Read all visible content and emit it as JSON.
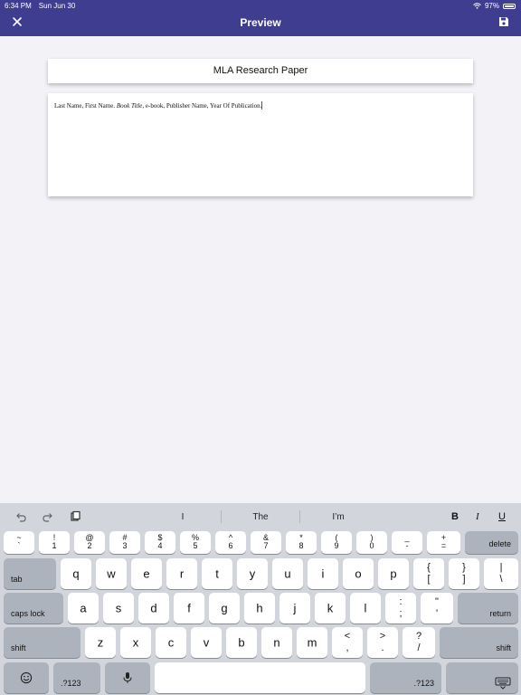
{
  "status_bar": {
    "time": "6:34 PM",
    "date": "Sun Jun 30",
    "battery": "97%"
  },
  "nav": {
    "title": "Preview"
  },
  "document": {
    "title": "MLA Research Paper",
    "citation_pre": "Last Name, First Name. ",
    "citation_italic": "Book Title",
    "citation_post": ", e-book, Publisher Name, Year Of Publication."
  },
  "keyboard": {
    "suggestions": [
      "I",
      "The",
      "I’m"
    ],
    "format": {
      "bold": "B",
      "italic": "I",
      "underline": "U"
    },
    "number_row": [
      {
        "top": "~",
        "bottom": "`"
      },
      {
        "top": "!",
        "bottom": "1"
      },
      {
        "top": "@",
        "bottom": "2"
      },
      {
        "top": "#",
        "bottom": "3"
      },
      {
        "top": "$",
        "bottom": "4"
      },
      {
        "top": "%",
        "bottom": "5"
      },
      {
        "top": "^",
        "bottom": "6"
      },
      {
        "top": "&",
        "bottom": "7"
      },
      {
        "top": "*",
        "bottom": "8"
      },
      {
        "top": "(",
        "bottom": "9"
      },
      {
        "top": ")",
        "bottom": "0"
      },
      {
        "top": "_",
        "bottom": "-"
      },
      {
        "top": "+",
        "bottom": "="
      }
    ],
    "row_q": [
      "q",
      "w",
      "e",
      "r",
      "t",
      "y",
      "u",
      "i",
      "o",
      "p"
    ],
    "row_q_sym": [
      {
        "top": "{",
        "bottom": "["
      },
      {
        "top": "}",
        "bottom": "]"
      },
      {
        "top": "|",
        "bottom": "\\"
      }
    ],
    "row_a": [
      "a",
      "s",
      "d",
      "f",
      "g",
      "h",
      "j",
      "k",
      "l"
    ],
    "row_a_sym": [
      {
        "top": ":",
        "bottom": ";"
      },
      {
        "top": "\"",
        "bottom": "'"
      }
    ],
    "row_z": [
      "z",
      "x",
      "c",
      "v",
      "b",
      "n",
      "m"
    ],
    "row_z_sym": [
      {
        "top": "<",
        "bottom": ","
      },
      {
        "top": ">",
        "bottom": "."
      },
      {
        "top": "?",
        "bottom": "/"
      }
    ],
    "delete": "delete",
    "tab": "tab",
    "caps_lock": "caps lock",
    "return": "return",
    "shift": "shift",
    "numbers": ".?123"
  }
}
